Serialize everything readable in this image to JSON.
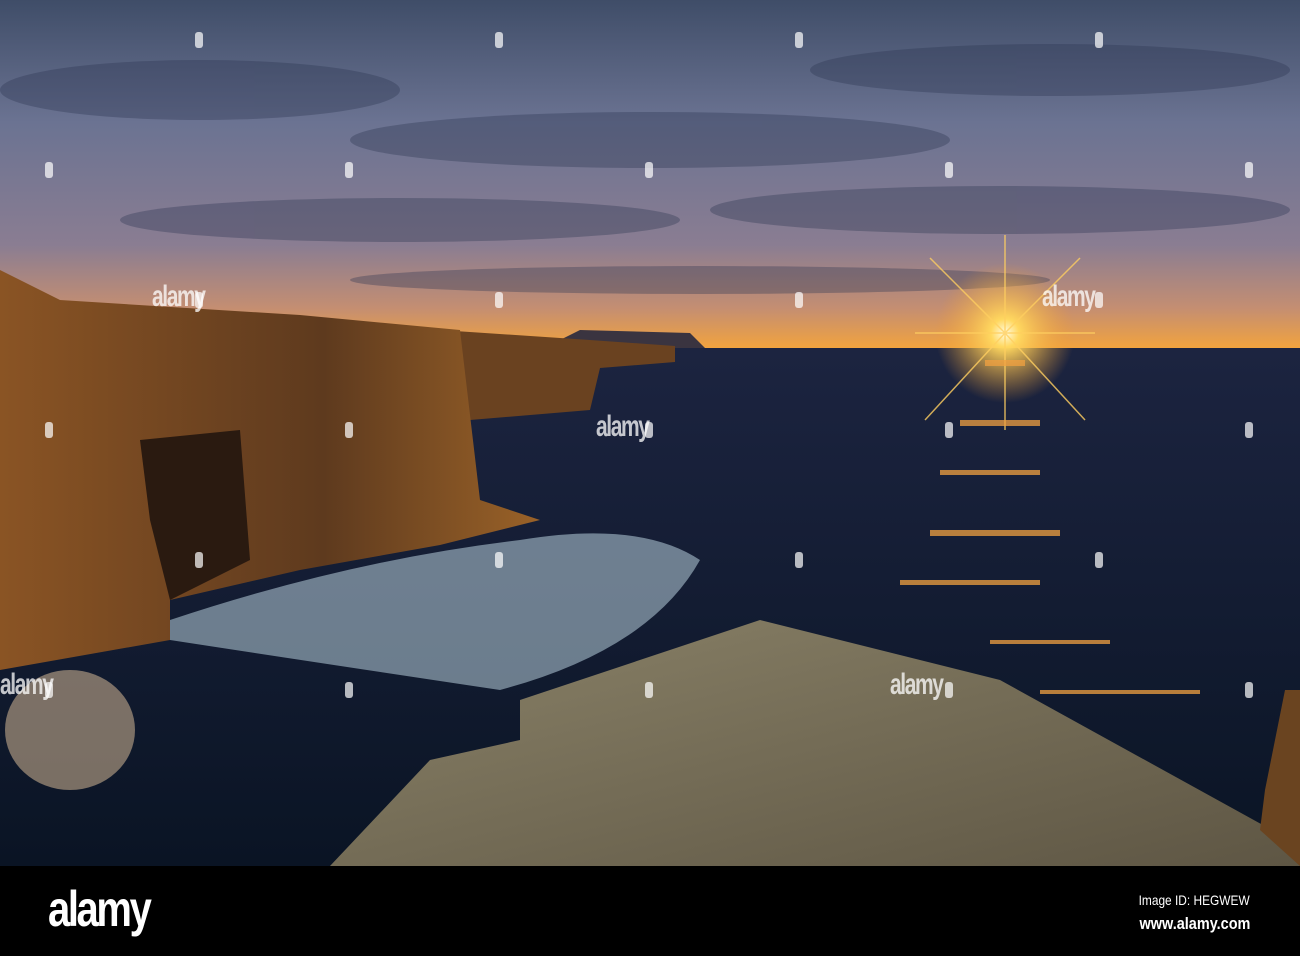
{
  "photo": {
    "subject": "sunset over sea cliffs"
  },
  "watermark": {
    "text": "alamy"
  },
  "footer": {
    "logo": "alamy",
    "image_id": "Image ID: HEGWEW",
    "website": "www.alamy.com"
  },
  "colors": {
    "sky_top": "#4a5772",
    "horizon": "#f3a640",
    "sea": "#0e1830",
    "cliff": "#7a4a22",
    "rock": "#7b7560"
  }
}
